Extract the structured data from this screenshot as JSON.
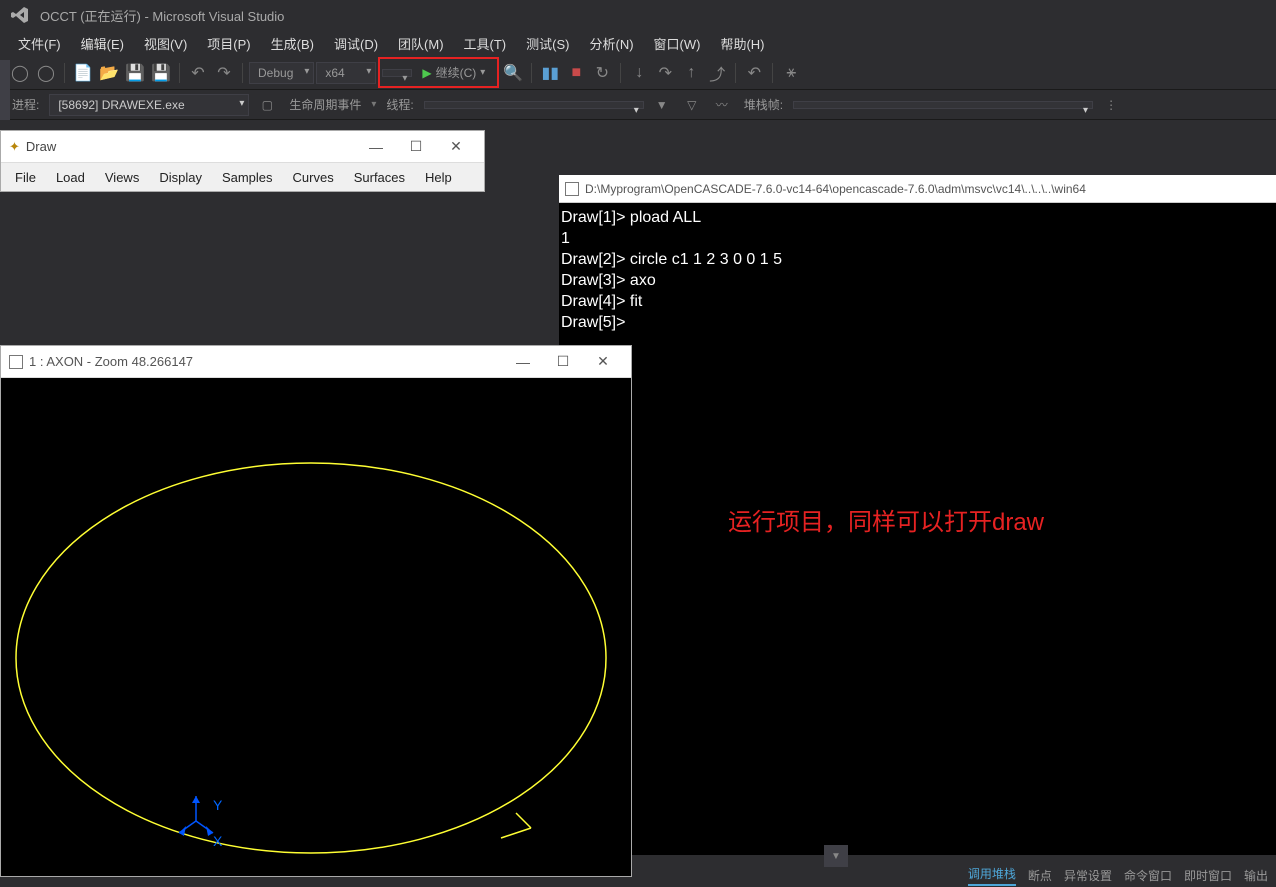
{
  "titlebar": {
    "title": "OCCT (正在运行) - Microsoft Visual Studio"
  },
  "menubar": {
    "items": [
      "文件(F)",
      "编辑(E)",
      "视图(V)",
      "项目(P)",
      "生成(B)",
      "调试(D)",
      "团队(M)",
      "工具(T)",
      "测试(S)",
      "分析(N)",
      "窗口(W)",
      "帮助(H)"
    ]
  },
  "toolbar": {
    "config": "Debug",
    "platform": "x64",
    "continue": "继续(C)"
  },
  "toolbar2": {
    "process_label": "进程:",
    "process_value": "[58692] DRAWEXE.exe",
    "lifecycle": "生命周期事件",
    "thread_label": "线程:",
    "stack_label": "堆栈帧:"
  },
  "draw_window": {
    "title": "Draw",
    "menu": [
      "File",
      "Load",
      "Views",
      "Display",
      "Samples",
      "Curves",
      "Surfaces",
      "Help"
    ]
  },
  "axon_window": {
    "title": "1 : AXON - Zoom 48.266147",
    "axis_x": "X",
    "axis_y": "Y"
  },
  "console": {
    "title": "D:\\Myprogram\\OpenCASCADE-7.6.0-vc14-64\\opencascade-7.6.0\\adm\\msvc\\vc14\\..\\..\\..\\win64",
    "lines": [
      "Draw[1]> pload ALL",
      "1",
      "Draw[2]> circle c1 1 2 3 0 0 1 5",
      "Draw[3]> axo",
      "Draw[4]> fit",
      "Draw[5]>"
    ]
  },
  "annotation": {
    "text": "运行项目，同样可以打开draw"
  },
  "bottom_tabs": {
    "items": [
      "调用堆栈",
      "断点",
      "异常设置",
      "命令窗口",
      "即时窗口",
      "输出"
    ],
    "active_index": 0
  }
}
